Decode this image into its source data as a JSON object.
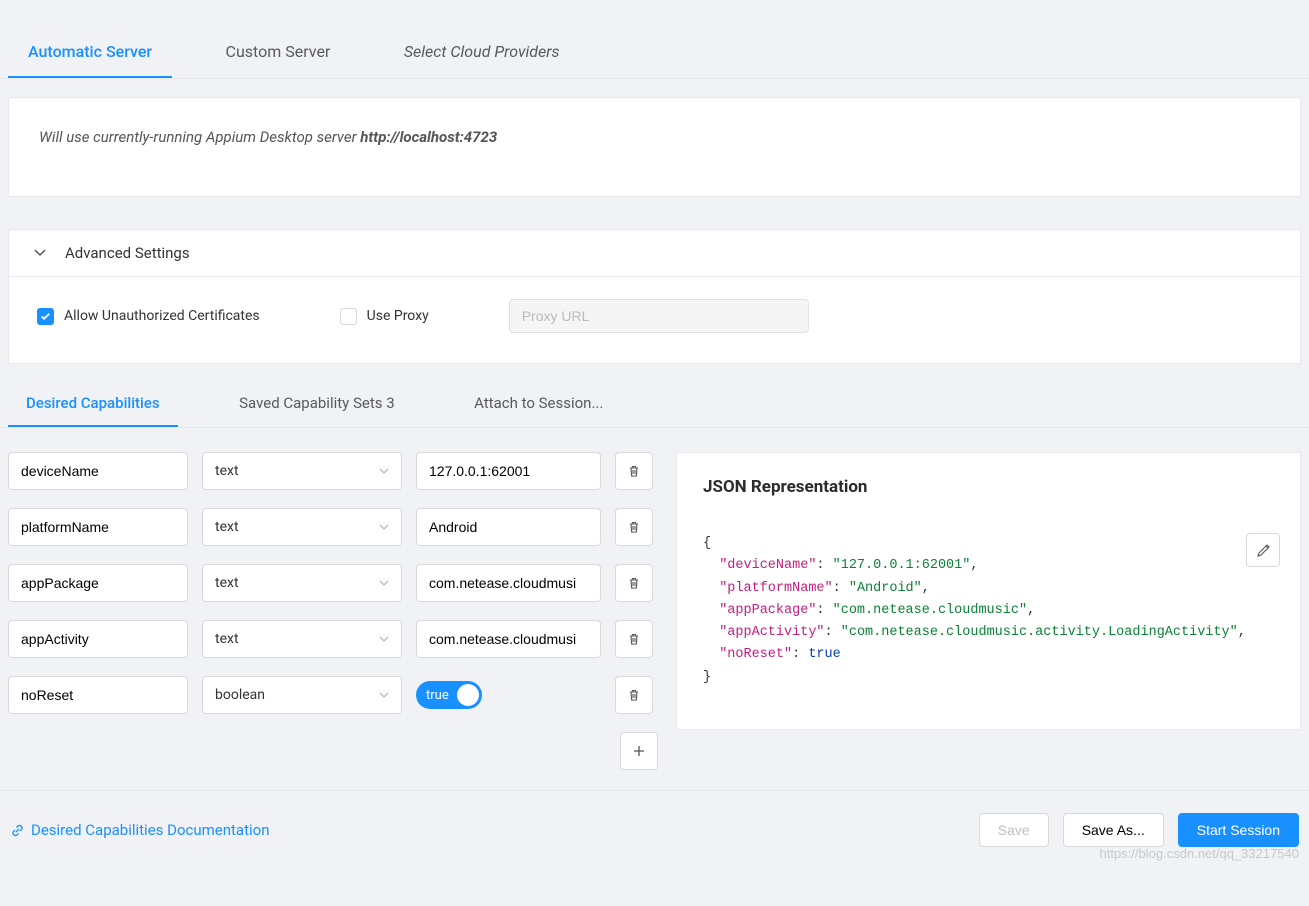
{
  "topTabs": {
    "automatic": "Automatic Server",
    "custom": "Custom Server",
    "cloud": "Select Cloud Providers"
  },
  "info": {
    "prefix": "Will use currently-running Appium Desktop server ",
    "url": "http://localhost:4723"
  },
  "advanced": {
    "title": "Advanced Settings",
    "allowUnauthorized": {
      "label": "Allow Unauthorized Certificates",
      "checked": true
    },
    "useProxy": {
      "label": "Use Proxy",
      "checked": false
    },
    "proxyPlaceholder": "Proxy URL"
  },
  "midTabs": {
    "desired": "Desired Capabilities",
    "saved": "Saved Capability Sets 3",
    "attach": "Attach to Session..."
  },
  "caps": [
    {
      "name": "deviceName",
      "type": "text",
      "value": "127.0.0.1:62001"
    },
    {
      "name": "platformName",
      "type": "text",
      "value": "Android"
    },
    {
      "name": "appPackage",
      "type": "text",
      "value": "com.netease.cloudmusi"
    },
    {
      "name": "appActivity",
      "type": "text",
      "value": "com.netease.cloudmusi"
    },
    {
      "name": "noReset",
      "type": "boolean",
      "value": "true"
    }
  ],
  "json": {
    "title": "JSON Representation",
    "deviceName": "127.0.0.1:62001",
    "platformName": "Android",
    "appPackage": "com.netease.cloudmusic",
    "appActivity": "com.netease.cloudmusic.activity.LoadingActivity",
    "noReset": "true"
  },
  "footer": {
    "docLink": "Desired Capabilities Documentation",
    "save": "Save",
    "saveAs": "Save As...",
    "start": "Start Session",
    "watermark": "https://blog.csdn.net/qq_33217540"
  }
}
